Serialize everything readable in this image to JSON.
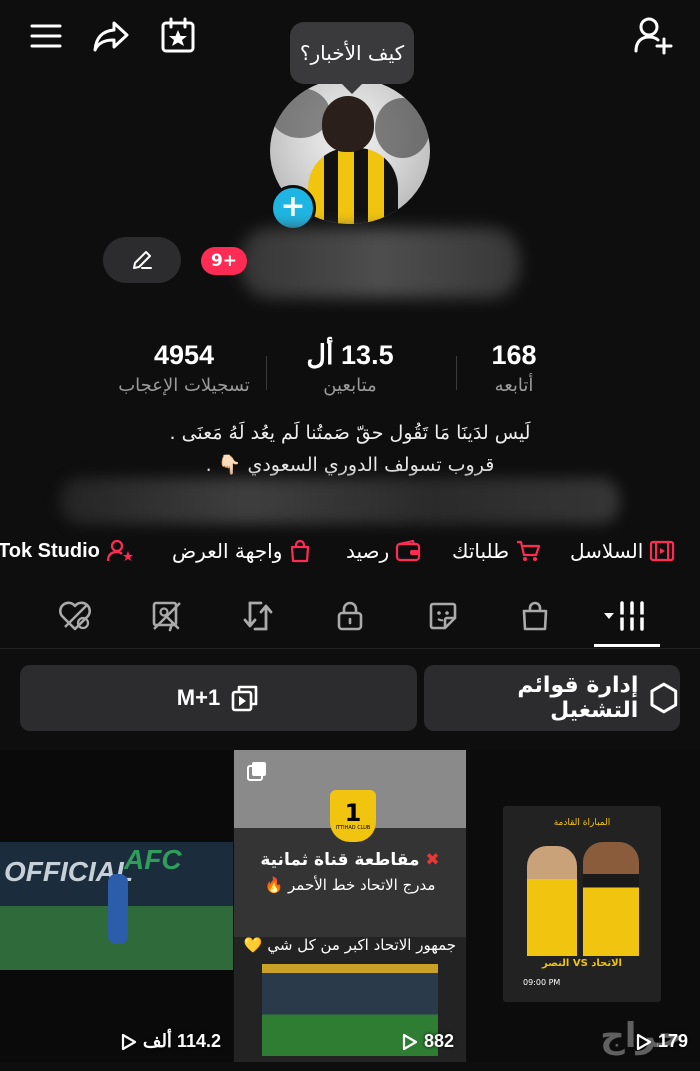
{
  "header": {
    "tooltip": "كيف الأخبار؟",
    "icons": [
      "menu-icon",
      "share-icon",
      "calendar-star-icon",
      "add-user-icon"
    ]
  },
  "profile": {
    "notification_count": "9+",
    "stats": [
      {
        "value": "168",
        "label": "أتابعه"
      },
      {
        "value": "13.5 أل",
        "label": "متابعين"
      },
      {
        "value": "4954",
        "label": "تسجيلات الإعجاب"
      }
    ],
    "bio_line1": "لَيس لدَينَا مَا تَقُول حقّ صَمتُنا لَم يعُد لَهُ مَعنَى .",
    "bio_line2": "قروب تسولف الدوري السعودي 👇🏻 ."
  },
  "shortcuts": [
    {
      "label": "السلاسل",
      "icon": "film-icon"
    },
    {
      "label": "طلباتك",
      "icon": "cart-icon"
    },
    {
      "label": "رصيد",
      "icon": "wallet-icon"
    },
    {
      "label": "واجهة العرض",
      "icon": "bag-icon"
    },
    {
      "label": "Tok Studio",
      "icon": "user-star-icon"
    }
  ],
  "tabs": [
    "grid-icon",
    "bag-icon",
    "sticker-icon",
    "lock-icon",
    "repost-icon",
    "tag-icon",
    "liked-icon"
  ],
  "actions": {
    "playlists_label": "إدارة قوائم التشغيل",
    "m1_label": "M+1"
  },
  "videos": [
    {
      "views": "179",
      "poster_title": "المباراة القادمة",
      "poster_match": "الاتحاد VS النصر",
      "poster_time": "09:00 PM"
    },
    {
      "views": "882",
      "logo_text": "ITTIHAD CLUB",
      "line1": "مقاطعة قناة ثمانية",
      "line2": "مدرج الاتحاد خط الأحمر",
      "line3": "جمهور الاتحاد اكبر من كل شي"
    },
    {
      "views": "114.2 ألف",
      "overlay1": "OFFICIAL",
      "overlay2": "AFC"
    }
  ],
  "watermark": "حراج",
  "colors": {
    "accent": "#fe2c55",
    "plus_badge": "#1fb5e3",
    "background": "#0e0e0e"
  }
}
